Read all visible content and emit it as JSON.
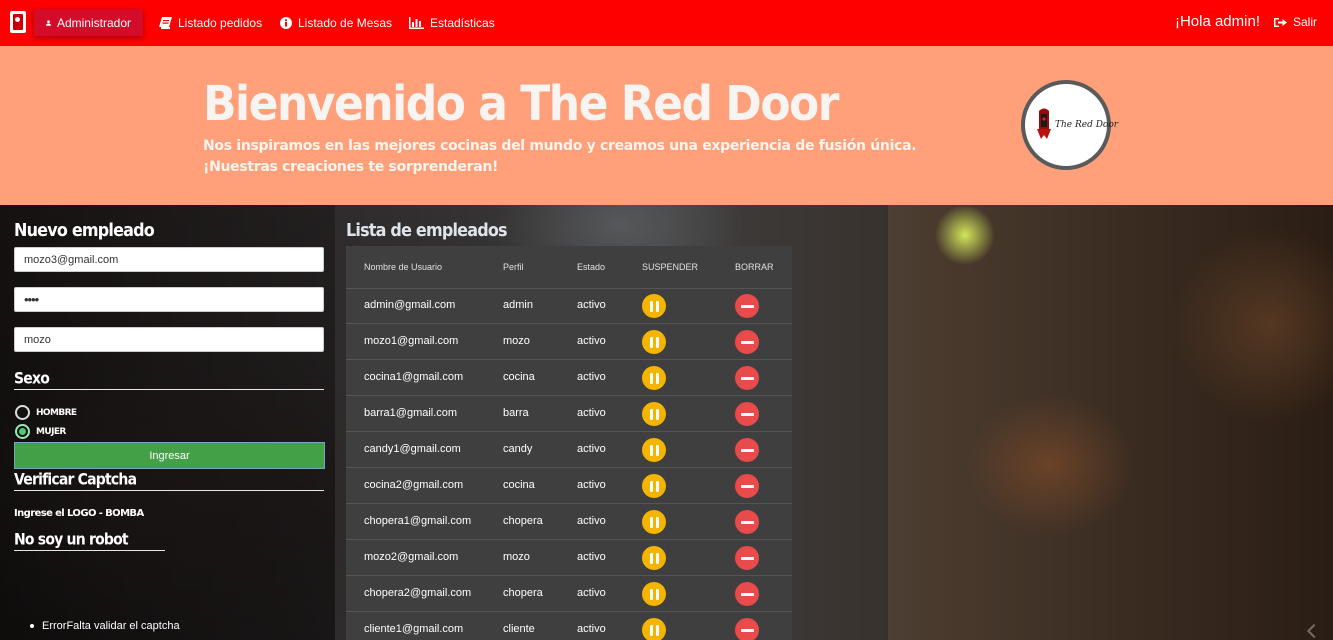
{
  "navbar": {
    "items": [
      {
        "label": "Administrador",
        "icon": "user-icon"
      },
      {
        "label": "Listado pedidos",
        "icon": "book-icon"
      },
      {
        "label": "Listado de Mesas",
        "icon": "info-icon"
      },
      {
        "label": "Estadísticas",
        "icon": "bar-chart-icon"
      }
    ],
    "greeting": "¡Hola admin!",
    "exit_label": "Salir"
  },
  "banner": {
    "title": "Bienvenido a The Red Door",
    "subtitle": "Nos inspiramos en las mejores cocinas del mundo y creamos una experiencia de fusión única. ¡Nuestras creaciones te sorprenderan!",
    "logo_text": "The Red Door"
  },
  "form": {
    "heading": "Nuevo empleado",
    "email_value": "mozo3@gmail.com",
    "password_value": "••••",
    "profile_value": "mozo",
    "sex_heading": "Sexo",
    "sex_options": [
      {
        "label": "HOMBRE",
        "checked": false
      },
      {
        "label": "MUJER",
        "checked": true
      }
    ],
    "submit_label": "Ingresar",
    "captcha_heading": "Verificar Captcha",
    "captcha_hint": "Ingrese el LOGO - BOMBA",
    "robot_heading": "No soy un robot",
    "errors": [
      "ErrorFalta validar el captcha"
    ]
  },
  "employees": {
    "heading": "Lista de empleados",
    "columns": [
      "Nombre de Usuario",
      "Perfil",
      "Estado",
      "SUSPENDER",
      "BORRAR"
    ],
    "rows": [
      {
        "user": "admin@gmail.com",
        "profile": "admin",
        "status": "activo"
      },
      {
        "user": "mozo1@gmail.com",
        "profile": "mozo",
        "status": "activo"
      },
      {
        "user": "cocina1@gmail.com",
        "profile": "cocina",
        "status": "activo"
      },
      {
        "user": "barra1@gmail.com",
        "profile": "barra",
        "status": "activo"
      },
      {
        "user": "candy1@gmail.com",
        "profile": "candy",
        "status": "activo"
      },
      {
        "user": "cocina2@gmail.com",
        "profile": "cocina",
        "status": "activo"
      },
      {
        "user": "chopera1@gmail.com",
        "profile": "chopera",
        "status": "activo"
      },
      {
        "user": "mozo2@gmail.com",
        "profile": "mozo",
        "status": "activo"
      },
      {
        "user": "chopera2@gmail.com",
        "profile": "chopera",
        "status": "activo"
      },
      {
        "user": "cliente1@gmail.com",
        "profile": "cliente",
        "status": "activo"
      }
    ]
  },
  "colors": {
    "navbar": "#fe0000",
    "nav_active": "#d50b2a",
    "banner": "#ffa07a",
    "submit": "#43a047",
    "suspend": "#f4b400",
    "delete": "#e94b4b"
  }
}
